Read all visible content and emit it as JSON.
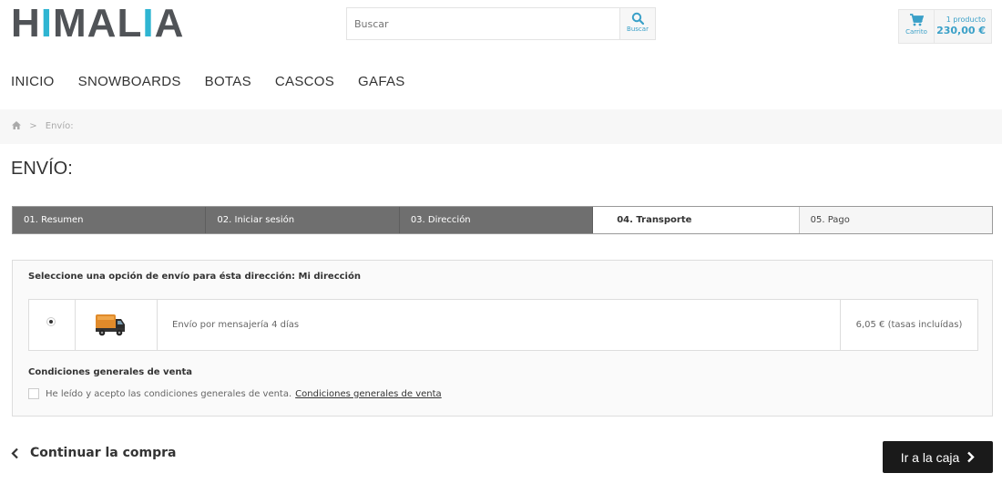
{
  "header": {
    "logo_part1": "H",
    "logo_accent1": "I",
    "logo_part2": "MAL",
    "logo_accent2": "I",
    "logo_part3": "A",
    "search_placeholder": "Buscar",
    "search_button_label": "Buscar",
    "cart_label": "Carrito",
    "cart_count": "1 producto",
    "cart_total": "230,00 €"
  },
  "nav": [
    "INICIO",
    "SNOWBOARDS",
    "BOTAS",
    "CASCOS",
    "GAFAS"
  ],
  "breadcrumb": {
    "sep": ">",
    "current": "Envío:"
  },
  "page_title": "ENVÍO:",
  "steps": [
    {
      "label": "01. Resumen",
      "state": "done"
    },
    {
      "label": "02. Iniciar sesión",
      "state": "done"
    },
    {
      "label": "03. Dirección",
      "state": "done"
    },
    {
      "label": "04. Transporte",
      "state": "current"
    },
    {
      "label": "05. Pago",
      "state": "todo"
    }
  ],
  "delivery": {
    "title": "Seleccione una opción de envío para ésta dirección: Mi dirección",
    "option_desc": "Envío por mensajería 4 días",
    "option_price": "6,05 € (tasas incluídas)",
    "selected": true
  },
  "terms": {
    "title": "Condiciones generales de venta",
    "text": "He leído y acepto las condiciones generales de venta.",
    "link": "Condiciones generales de venta"
  },
  "actions": {
    "continue_label": "Continuar la compra",
    "checkout_label": "Ir a la caja"
  },
  "colors": {
    "accent": "#2fb5d2",
    "dark": "#1a1a1a",
    "step_done": "#6f6f6f"
  }
}
